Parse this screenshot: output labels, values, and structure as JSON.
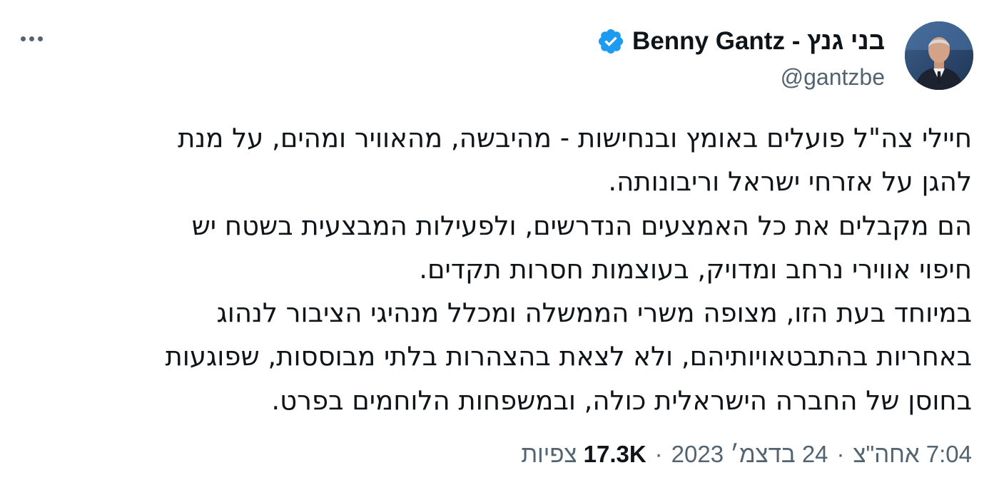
{
  "author": {
    "display_name": "בני גנץ - Benny Gantz",
    "handle": "@gantzbe",
    "verified": true,
    "verified_icon": "verified-badge-icon",
    "avatar_icon": "profile-photo"
  },
  "more_icon": "more-options-icon",
  "tweet": {
    "lines": [
      "חיילי צה\"ל פועלים באומץ ובנחישות - מהיבשה, מהאוויר ומהים, על מנת",
      "להגן על אזרחי ישראל וריבונותה.",
      "הם מקבלים את כל האמצעים הנדרשים, ולפעילות המבצעית בשטח יש",
      "חיפוי אווירי נרחב ומדויק, בעוצמות חסרות תקדים.",
      "במיוחד בעת הזו, מצופה משרי הממשלה ומכלל מנהיגי הציבור לנהוג",
      "באחריות בהתבטאויותיהם, ולא לצאת בהצהרות בלתי מבוססות, שפוגעות",
      "בחוסן של החברה הישראלית כולה, ובמשפחות הלוחמים בפרט."
    ]
  },
  "meta": {
    "time": "7:04 אחה\"צ",
    "separator": "·",
    "date": "24 בדצמ׳ 2023",
    "views_count": "17.3K",
    "views_label": "צפיות"
  },
  "colors": {
    "text_primary": "#0f1419",
    "text_secondary": "#536471",
    "verified_blue": "#1d9bf0"
  }
}
